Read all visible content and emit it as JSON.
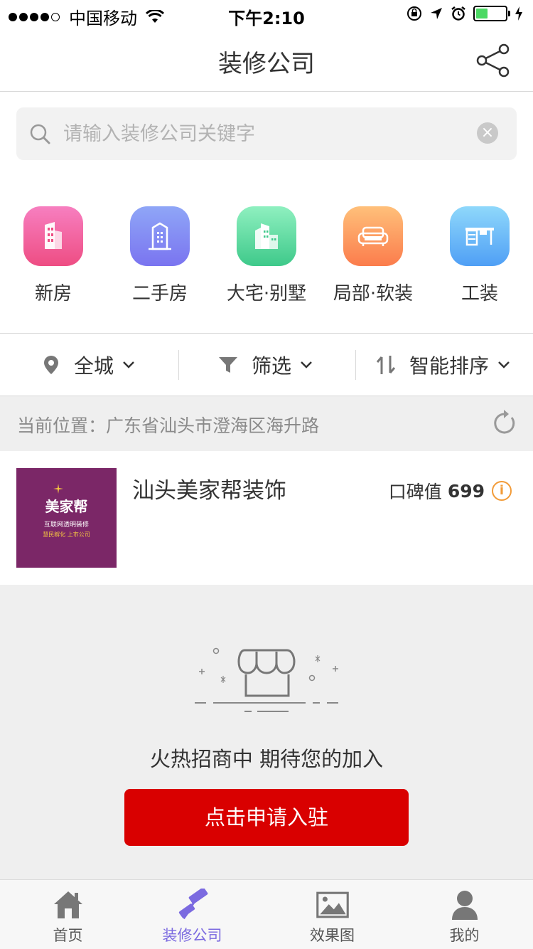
{
  "status_bar": {
    "carrier": "中国移动",
    "time": "下午2:10"
  },
  "nav": {
    "title": "装修公司",
    "share_icon": "share-icon"
  },
  "search": {
    "placeholder": "请输入装修公司关键字",
    "value": ""
  },
  "categories": [
    {
      "label": "新房",
      "icon": "building-icon",
      "color_top": "#f77fc0",
      "color_bottom": "#ee4d83"
    },
    {
      "label": "二手房",
      "icon": "apartment-icon",
      "color_top": "#8fa6f7",
      "color_bottom": "#7a74f0"
    },
    {
      "label": "大宅·别墅",
      "icon": "city-icon",
      "color_top": "#8ff0c0",
      "color_bottom": "#3ec98a"
    },
    {
      "label": "局部·软装",
      "icon": "sofa-icon",
      "color_top": "#ffc07a",
      "color_bottom": "#fb7c4c"
    },
    {
      "label": "工装",
      "icon": "desk-icon",
      "color_top": "#8fd8fb",
      "color_bottom": "#4f9ff5"
    }
  ],
  "filters": [
    {
      "label": "全城",
      "icon": "location-pin-icon"
    },
    {
      "label": "筛选",
      "icon": "funnel-icon"
    },
    {
      "label": "智能排序",
      "icon": "sort-icon"
    }
  ],
  "location": {
    "text": "当前位置：广东省汕头市澄海区海升路"
  },
  "company": {
    "name": "汕头美家帮装饰",
    "rating_label": "口碑值",
    "rating_value": "699",
    "logo_text": "美家帮",
    "logo_sub": "互联网透明装修",
    "logo_sub2": "慧民孵化 上市公司"
  },
  "promo": {
    "text": "火热招商中 期待您的加入",
    "button_label": "点击申请入驻"
  },
  "tabs": [
    {
      "label": "首页",
      "icon": "home-icon",
      "active": false
    },
    {
      "label": "装修公司",
      "icon": "paint-roller-icon",
      "active": true
    },
    {
      "label": "效果图",
      "icon": "image-icon",
      "active": false
    },
    {
      "label": "我的",
      "icon": "user-icon",
      "active": false
    }
  ],
  "colors": {
    "accent": "#d90000",
    "active_tab": "#7b6ae0",
    "rating_icon": "#f29b38",
    "logo_bg": "#7b2767"
  }
}
